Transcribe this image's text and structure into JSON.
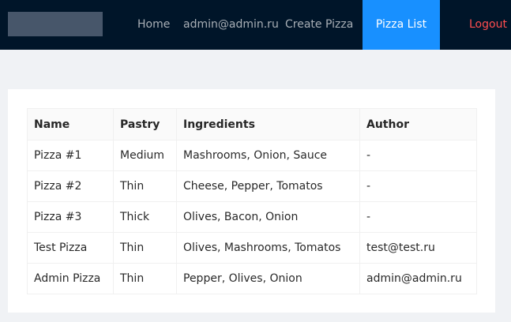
{
  "header": {
    "nav": {
      "home": "Home",
      "user": "admin@admin.ru",
      "create": "Create Pizza",
      "list": "Pizza List",
      "logout": "Logout"
    },
    "colors": {
      "background": "#001529",
      "active": "#1890ff",
      "logout": "#ff4d4f"
    }
  },
  "table": {
    "columns": [
      "Name",
      "Pastry",
      "Ingredients",
      "Author"
    ],
    "rows": [
      [
        "Pizza #1",
        "Medium",
        "Mashrooms, Onion, Sauce",
        "-"
      ],
      [
        "Pizza #2",
        "Thin",
        "Cheese, Pepper, Tomatos",
        "-"
      ],
      [
        "Pizza #3",
        "Thick",
        "Olives, Bacon, Onion",
        "-"
      ],
      [
        "Test Pizza",
        "Thin",
        "Olives, Mashrooms, Tomatos",
        "test@test.ru"
      ],
      [
        "Admin Pizza",
        "Thin",
        "Pepper, Olives, Onion",
        "admin@admin.ru"
      ]
    ]
  }
}
